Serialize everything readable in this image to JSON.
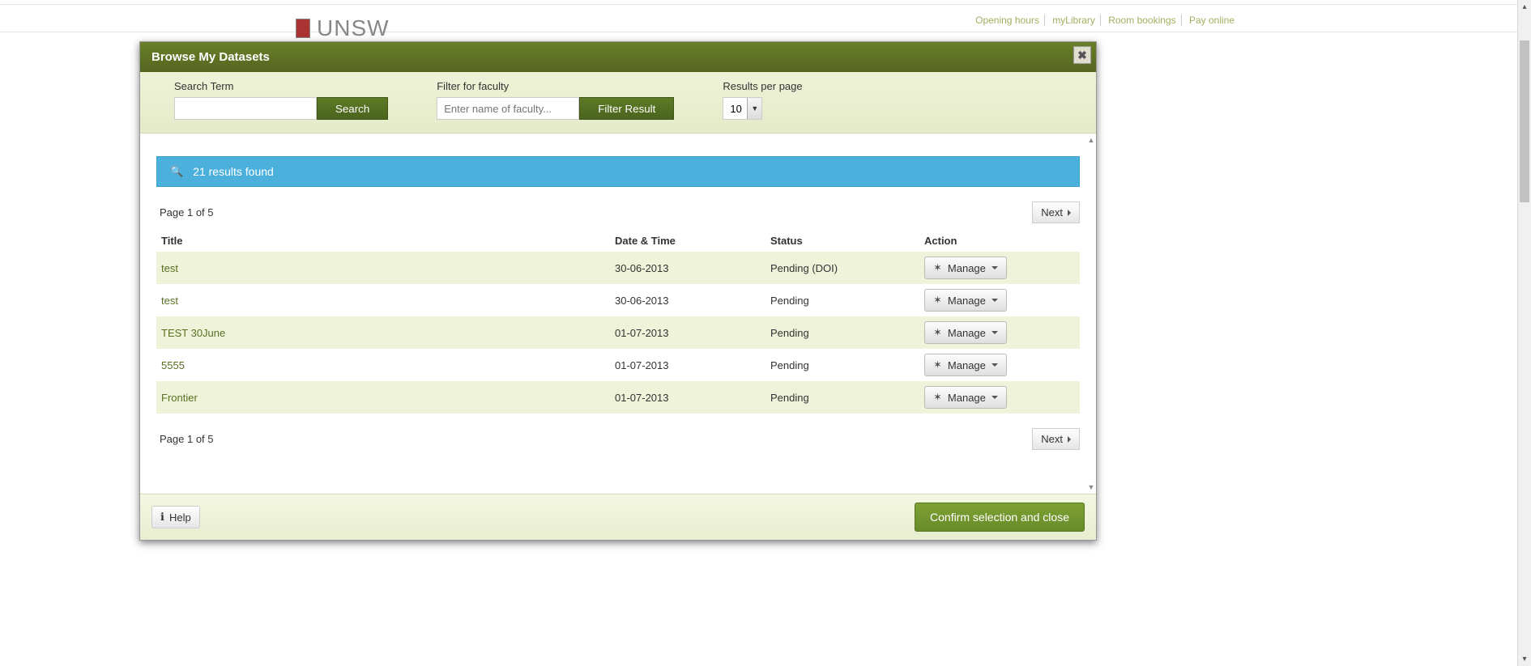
{
  "background": {
    "brand": "UNSW",
    "top_links": [
      "Opening hours",
      "myLibrary",
      "Room bookings",
      "Pay online"
    ]
  },
  "modal": {
    "title": "Browse My Datasets",
    "close_icon": "close-icon"
  },
  "filters": {
    "search_label": "Search Term",
    "search_value": "",
    "search_button": "Search",
    "faculty_label": "Filter for faculty",
    "faculty_placeholder": "Enter name of faculty...",
    "faculty_value": "",
    "filter_button": "Filter Result",
    "rpp_label": "Results per page",
    "rpp_value": "10"
  },
  "results": {
    "banner_text": "21 results found",
    "page_info_top": "Page 1 of 5",
    "page_info_bottom": "Page 1 of 5",
    "next_label": "Next",
    "columns": {
      "title": "Title",
      "date": "Date & Time",
      "status": "Status",
      "action": "Action"
    },
    "manage_label": "Manage",
    "rows": [
      {
        "title": "test",
        "date": "30-06-2013",
        "status": "Pending (DOI)"
      },
      {
        "title": "test",
        "date": "30-06-2013",
        "status": "Pending"
      },
      {
        "title": "TEST 30June",
        "date": "01-07-2013",
        "status": "Pending"
      },
      {
        "title": "5555",
        "date": "01-07-2013",
        "status": "Pending"
      },
      {
        "title": "Frontier",
        "date": "01-07-2013",
        "status": "Pending"
      }
    ]
  },
  "footer": {
    "help_label": "Help",
    "confirm_label": "Confirm selection and close"
  }
}
